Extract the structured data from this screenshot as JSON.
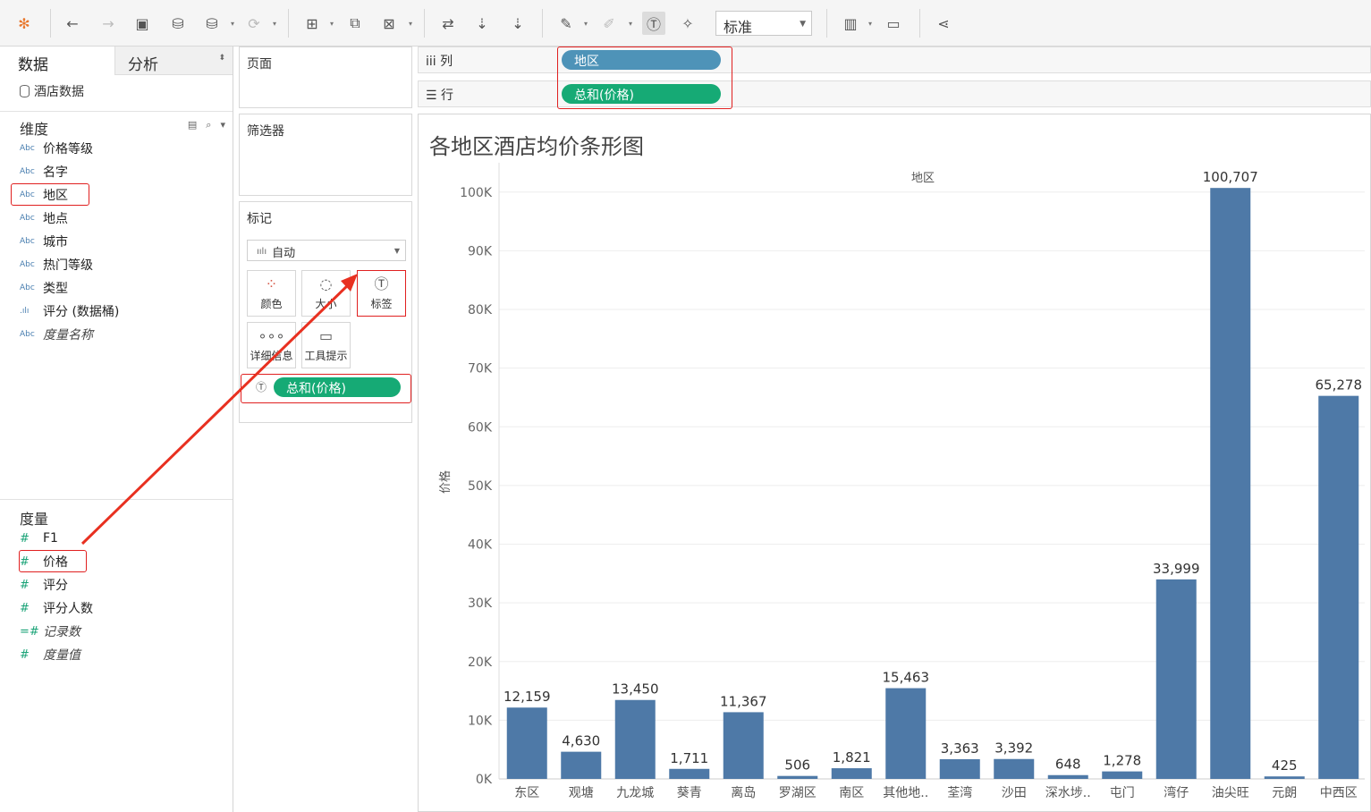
{
  "toolbar": {
    "fit_value": "标准",
    "icons": [
      "tableau-logo-icon",
      "undo-icon",
      "redo-icon",
      "save-icon",
      "new-datasource-icon",
      "pause-autoupdate-icon",
      "refresh-icon",
      "new-worksheet-icon",
      "duplicate-sheet-icon",
      "clear-sheet-icon",
      "swap-icon",
      "sort-ascending-icon",
      "sort-descending-icon",
      "highlight-icon",
      "group-icon",
      "show-labels-icon",
      "pin-icon",
      "show-me-icon",
      "presentation-icon",
      "share-icon"
    ]
  },
  "data_pane": {
    "tab_data": "数据",
    "tab_analysis": "分析",
    "datasource": "酒店数据",
    "dimensions_header": "维度",
    "dimensions": [
      {
        "type": "Abc",
        "name": "价格等级"
      },
      {
        "type": "Abc",
        "name": "名字"
      },
      {
        "type": "Abc",
        "name": "地区"
      },
      {
        "type": "Abc",
        "name": "地点"
      },
      {
        "type": "Abc",
        "name": "城市"
      },
      {
        "type": "Abc",
        "name": "热门等级"
      },
      {
        "type": "Abc",
        "name": "类型"
      },
      {
        "type": "bin",
        "name": "评分 (数据桶)"
      },
      {
        "type": "Abc",
        "name": "度量名称"
      }
    ],
    "measures_header": "度量",
    "measures": [
      {
        "type": "#",
        "name": "F1"
      },
      {
        "type": "#",
        "name": "价格"
      },
      {
        "type": "#",
        "name": "评分"
      },
      {
        "type": "#",
        "name": "评分人数"
      },
      {
        "type": "=#",
        "name": "记录数"
      },
      {
        "type": "#",
        "name": "度量值"
      }
    ]
  },
  "cards": {
    "pages": "页面",
    "filters": "筛选器",
    "marks": "标记",
    "mark_type": "自动",
    "buttons": {
      "color": "颜色",
      "size": "大小",
      "label": "标签",
      "detail": "详细信息",
      "tooltip": "工具提示"
    },
    "label_pill": "总和(价格)"
  },
  "shelves": {
    "columns_label": "列",
    "rows_label": "行",
    "columns_pill": "地区",
    "rows_pill": "总和(价格)"
  },
  "view": {
    "title": "各地区酒店均价条形图"
  },
  "colors": {
    "bar": "#4e79a7",
    "highlight": "#e02020",
    "dim_pill": "#4e93b8",
    "measure_pill": "#16aa75"
  },
  "chart_data": {
    "type": "bar",
    "title": "各地区酒店均价条形图",
    "header": "地区",
    "xlabel": "",
    "ylabel": "价格",
    "ylim": [
      0,
      105000
    ],
    "yticks": [
      "0K",
      "10K",
      "20K",
      "30K",
      "40K",
      "50K",
      "60K",
      "70K",
      "80K",
      "90K",
      "100K"
    ],
    "grid": true,
    "categories": [
      "东区",
      "观塘",
      "九龙城",
      "葵青",
      "离岛",
      "罗湖区",
      "南区",
      "其他地..",
      "荃湾",
      "沙田",
      "深水埗..",
      "屯门",
      "湾仔",
      "油尖旺",
      "元朗",
      "中西区"
    ],
    "values": [
      12159,
      4630,
      13450,
      1711,
      11367,
      506,
      1821,
      15463,
      3363,
      3392,
      648,
      1278,
      33999,
      100707,
      425,
      65278
    ],
    "value_labels": [
      "12,159",
      "4,630",
      "13,450",
      "1,711",
      "11,367",
      "506",
      "1,821",
      "15,463",
      "3,363",
      "3,392",
      "648",
      "1,278",
      "33,999",
      "100,707",
      "425",
      "65,278"
    ]
  }
}
